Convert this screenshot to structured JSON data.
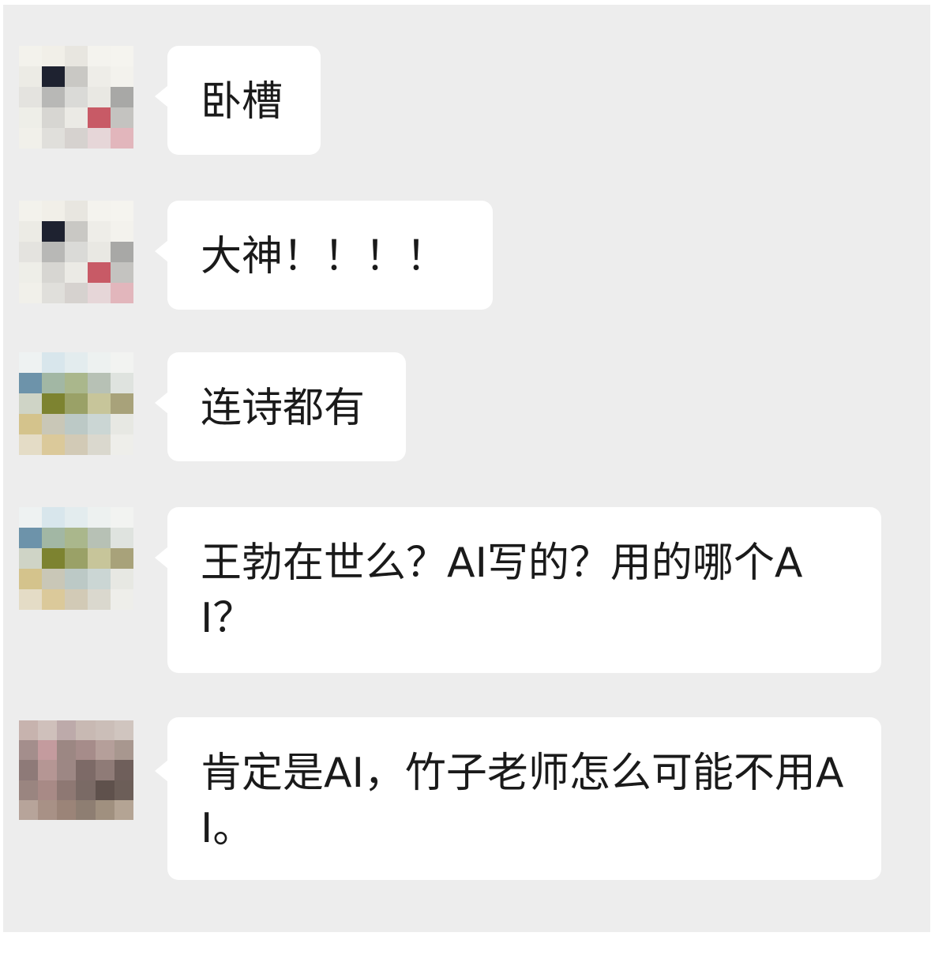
{
  "messages": [
    {
      "sender": "avatar-a",
      "text": "卧槽"
    },
    {
      "sender": "avatar-a",
      "text": "大神！！！！"
    },
    {
      "sender": "avatar-b",
      "text": "连诗都有"
    },
    {
      "sender": "avatar-b",
      "text": "王勃在世么？AI写的？用的哪个AI？"
    },
    {
      "sender": "avatar-c",
      "text": "肯定是AI，竹子老师怎么可能不用AI。"
    }
  ],
  "colors": {
    "background": "#ededed",
    "bubble": "#ffffff",
    "text": "#1a1a1a"
  },
  "icons": {
    "avatar-a": "pixelated-avatar-icon",
    "avatar-b": "pixelated-avatar-icon",
    "avatar-c": "pixelated-avatar-icon"
  }
}
